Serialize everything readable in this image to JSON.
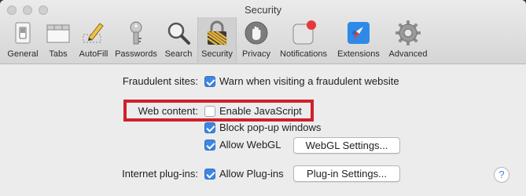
{
  "window": {
    "title": "Security"
  },
  "toolbar": {
    "items": [
      {
        "label": "General",
        "icon": "switch-icon"
      },
      {
        "label": "Tabs",
        "icon": "tabs-icon"
      },
      {
        "label": "AutoFill",
        "icon": "pencil-icon"
      },
      {
        "label": "Passwords",
        "icon": "key-icon"
      },
      {
        "label": "Search",
        "icon": "magnifier-icon"
      },
      {
        "label": "Security",
        "icon": "lock-icon",
        "selected": true
      },
      {
        "label": "Privacy",
        "icon": "hand-icon"
      },
      {
        "label": "Notifications",
        "icon": "notification-badge-icon"
      },
      {
        "label": "Extensions",
        "icon": "compass-puzzle-icon"
      },
      {
        "label": "Advanced",
        "icon": "gear-icon"
      }
    ]
  },
  "settings": {
    "fraudulent": {
      "label": "Fraudulent sites:",
      "option": "Warn when visiting a fraudulent website",
      "checked": true
    },
    "web_content": {
      "label": "Web content:",
      "javascript": {
        "option": "Enable JavaScript",
        "checked": false
      },
      "popups": {
        "option": "Block pop-up windows",
        "checked": true
      },
      "webgl": {
        "option": "Allow WebGL",
        "checked": true,
        "button": "WebGL Settings..."
      }
    },
    "plugins": {
      "label": "Internet plug-ins:",
      "option": "Allow Plug-ins",
      "checked": true,
      "button": "Plug-in Settings..."
    }
  },
  "help": {
    "label": "?"
  },
  "colors": {
    "accent": "#3d86e2",
    "highlight": "#d0202a",
    "notification_dot": "#e4393c"
  }
}
